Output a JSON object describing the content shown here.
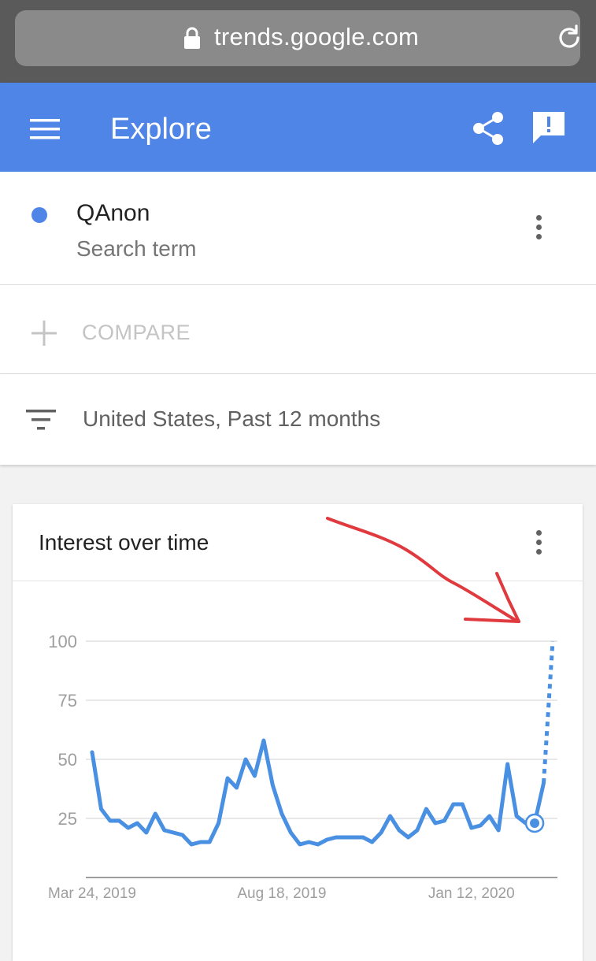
{
  "browser": {
    "url": "trends.google.com",
    "lock_icon": "lock-icon",
    "reload_icon": "reload-icon"
  },
  "appbar": {
    "title": "Explore",
    "menu_icon": "menu-icon",
    "share_icon": "share-icon",
    "feedback_icon": "feedback-icon",
    "color": "#5085e8"
  },
  "search_term": {
    "name": "QAnon",
    "subtitle": "Search term",
    "color": "#5085e8"
  },
  "compare": {
    "label": "COMPARE"
  },
  "filter": {
    "label": "United States, Past 12 months"
  },
  "card": {
    "title": "Interest over time"
  },
  "chart_data": {
    "type": "line",
    "title": "Interest over time",
    "xlabel": "",
    "ylabel": "",
    "ylim": [
      0,
      100
    ],
    "yticks": [
      "100",
      "75",
      "50",
      "25"
    ],
    "xticks": [
      "Mar 24, 2019",
      "Aug 18, 2019",
      "Jan 12, 2020"
    ],
    "grid": true,
    "series": [
      {
        "color": "#4a90e2",
        "x": [
          "2019-03-24",
          "2019-03-31",
          "2019-04-07",
          "2019-04-14",
          "2019-04-21",
          "2019-04-28",
          "2019-05-05",
          "2019-05-12",
          "2019-05-19",
          "2019-05-26",
          "2019-06-02",
          "2019-06-09",
          "2019-06-16",
          "2019-06-23",
          "2019-06-30",
          "2019-07-07",
          "2019-07-14",
          "2019-07-21",
          "2019-07-28",
          "2019-08-04",
          "2019-08-11",
          "2019-08-18",
          "2019-08-25",
          "2019-09-01",
          "2019-09-08",
          "2019-09-15",
          "2019-09-22",
          "2019-09-29",
          "2019-10-06",
          "2019-10-13",
          "2019-10-20",
          "2019-10-27",
          "2019-11-03",
          "2019-11-10",
          "2019-11-17",
          "2019-11-24",
          "2019-12-01",
          "2019-12-08",
          "2019-12-15",
          "2019-12-22",
          "2019-12-29",
          "2020-01-05",
          "2020-01-12",
          "2020-01-19",
          "2020-01-26",
          "2020-02-02",
          "2020-02-09",
          "2020-02-16",
          "2020-02-23",
          "2020-03-01",
          "2020-03-08",
          "2020-03-15"
        ],
        "values": [
          53,
          29,
          24,
          24,
          21,
          23,
          19,
          27,
          20,
          19,
          18,
          14,
          15,
          15,
          23,
          42,
          38,
          50,
          43,
          58,
          39,
          27,
          19,
          14,
          15,
          14,
          16,
          17,
          17,
          17,
          17,
          15,
          19,
          26,
          20,
          17,
          20,
          29,
          23,
          24,
          31,
          31,
          21,
          22,
          26,
          20,
          48,
          26,
          23,
          23,
          40,
          100
        ],
        "partial_from": "2020-03-08"
      }
    ]
  }
}
